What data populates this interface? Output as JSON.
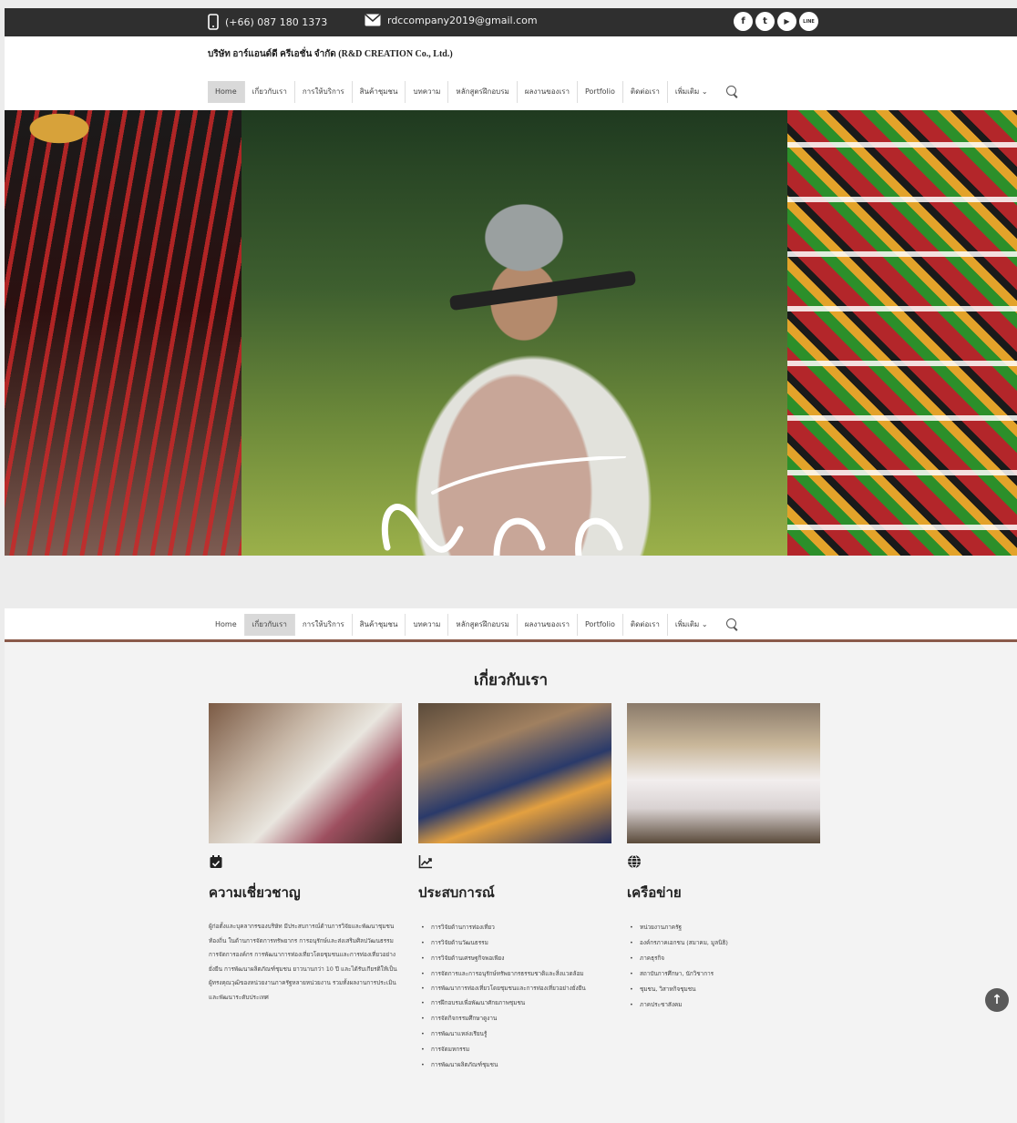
{
  "topbar": {
    "phone": "(+66) 087 180 1373",
    "email": "rdccompany2019@gmail.com",
    "socials": [
      {
        "icon": "facebook-icon",
        "glyph": "f"
      },
      {
        "icon": "twitter-icon",
        "glyph": "t"
      },
      {
        "icon": "youtube-icon",
        "glyph": "▶"
      },
      {
        "icon": "line-icon",
        "glyph": "LINE"
      }
    ]
  },
  "company_name": "บริษัท อาร์แอนด์ดี ครีเอชั่น จำกัด (R&D CREATION Co., Ltd.)",
  "nav": {
    "items": [
      "Home",
      "เกี่ยวกับเรา",
      "การให้บริการ",
      "สินค้าชุมชน",
      "บทความ",
      "หลักสูตรฝึกอบรม",
      "ผลงานของเรา",
      "Portfolio",
      "ติดต่อเรา",
      "เพิ่มเติม ⌄"
    ],
    "active_first": "Home",
    "active_second": "เกี่ยวกับเรา"
  },
  "about": {
    "title": "เกี่ยวกับเรา",
    "columns": [
      {
        "icon": "calendar-check-icon",
        "heading": "ความเชี่ยวชาญ",
        "body": "ผู้ก่อตั้งและบุคลากรของบริษัท มีประสบการณ์ด้านการวิจัยและพัฒนาชุมชน ท้องถิ่น ในด้านการจัดการทรัพยากร การอนุรักษ์และส่งเสริมศิลปวัฒนธรรม การจัดการองค์กร การพัฒนาการท่องเที่ยวโดยชุมชนและการท่องเที่ยวอย่างยั่งยืน การพัฒนาผลิตภัณฑ์ชุมชน ยาวนานกว่า 10 ปี และได้รับเกียรติให้เป็นผู้ทรงคุณวุฒิของหน่วยงานภาครัฐหลายหน่วยงาน รวมทั้งผลงานการประเมินและพัฒนาระดับประเทศ"
      },
      {
        "icon": "chart-line-icon",
        "heading": "ประสบการณ์",
        "items": [
          "การวิจัยด้านการท่องเที่ยว",
          "การวิจัยด้านวัฒนธรรม",
          "การวิจัยด้านเศรษฐกิจพอเพียง",
          "การจัดการและการอนุรักษ์ทรัพยากรธรรมชาติและสิ่งแวดล้อม",
          "การพัฒนาการท่องเที่ยวโดยชุมชนและการท่องเที่ยวอย่างยั่งยืน",
          "การฝึกอบรมเพื่อพัฒนาศักยภาพชุมชน",
          "การจัดกิจกรรมศึกษาดูงาน",
          "การพัฒนาแหล่งเรียนรู้",
          "การจัดมหกรรม",
          "การพัฒนาผลิตภัณฑ์ชุมชน"
        ]
      },
      {
        "icon": "globe-icon",
        "heading": "เครือข่าย",
        "items": [
          "หน่วยงานภาครัฐ",
          "องค์กรภาคเอกชน (สมาคม, มูลนิธิ)",
          "ภาคธุรกิจ",
          "สถาบันการศึกษา, นักวิชาการ",
          "ชุมชน, วิสาหกิจชุมชน",
          "ภาคประชาสังคม"
        ]
      }
    ]
  },
  "back_to_top": "↑",
  "colors": {
    "topbar": "#2f2f2f",
    "accent_line": "#8a5a4a",
    "page_bg": "#f3f3f3"
  }
}
